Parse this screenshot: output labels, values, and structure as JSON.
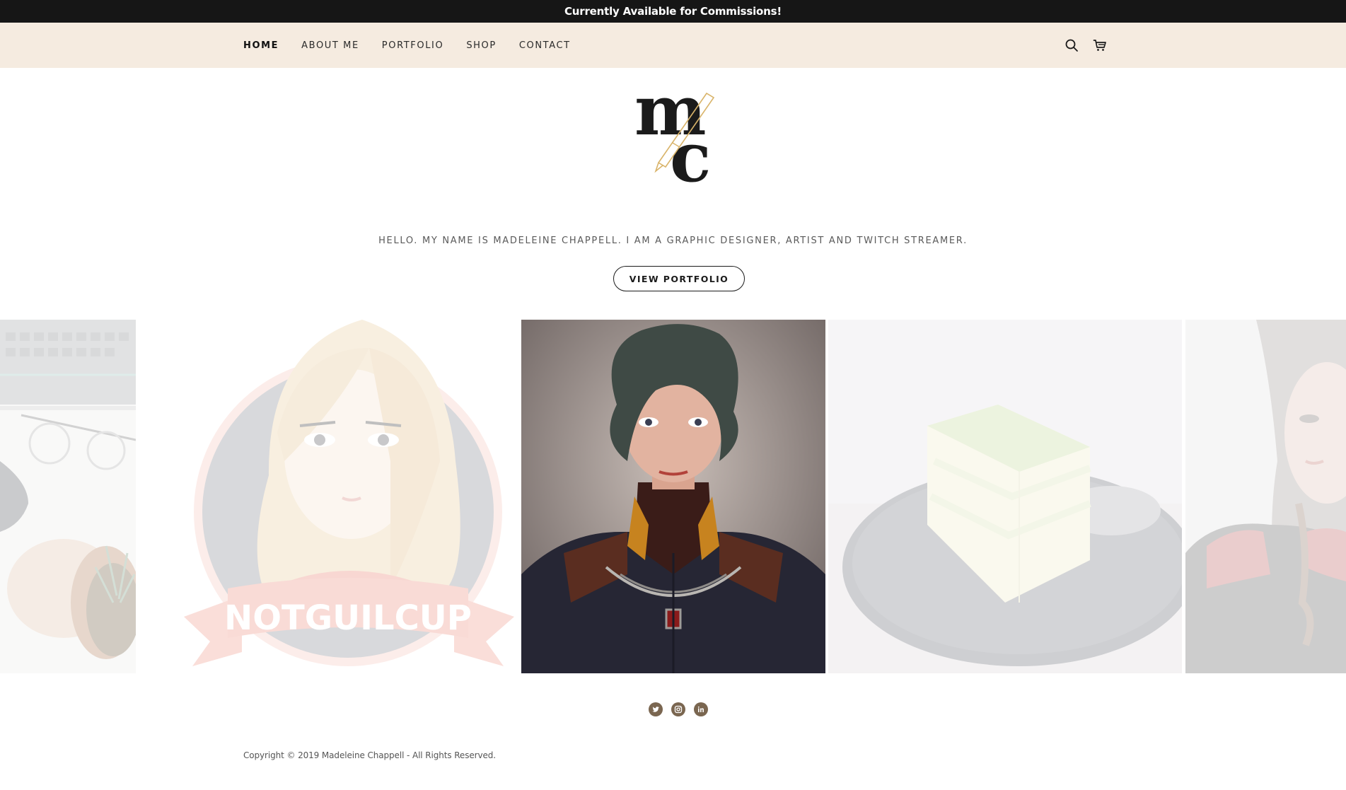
{
  "announcement": {
    "text": "Currently Available for Commissions!"
  },
  "nav": {
    "links": [
      {
        "label": "HOME",
        "active": true
      },
      {
        "label": "ABOUT ME",
        "active": false
      },
      {
        "label": "PORTFOLIO",
        "active": false
      },
      {
        "label": "SHOP",
        "active": false
      },
      {
        "label": "CONTACT",
        "active": false
      }
    ],
    "icons": [
      "search-icon",
      "cart-icon"
    ]
  },
  "logo": {
    "letters": "mc",
    "icon": "pen-icon",
    "accent": "#d9b46a"
  },
  "hero": {
    "tagline": "HELLO. MY NAME IS MADELEINE CHAPPELL. I AM A GRAPHIC DESIGNER, ARTIST AND TWITCH STREAMER.",
    "button_label": "VIEW PORTFOLIO"
  },
  "gallery": {
    "slides": [
      {
        "name": "desk-photo",
        "faded": true
      },
      {
        "name": "notguilcup-avatar",
        "faded": true,
        "banner_text": "NOTGUILCUP"
      },
      {
        "name": "portrait-painting",
        "faded": false
      },
      {
        "name": "cake-photo",
        "faded": true
      },
      {
        "name": "selfie-photo",
        "faded": true
      }
    ]
  },
  "social": {
    "icons": [
      "twitter-icon",
      "instagram-icon",
      "linkedin-icon"
    ],
    "color": "#7a6650"
  },
  "footer": {
    "copyright": "Copyright © 2019 Madeleine Chappell - All Rights Reserved."
  },
  "colors": {
    "nav_bg": "#f5ebe0",
    "announce_bg": "#161616"
  }
}
